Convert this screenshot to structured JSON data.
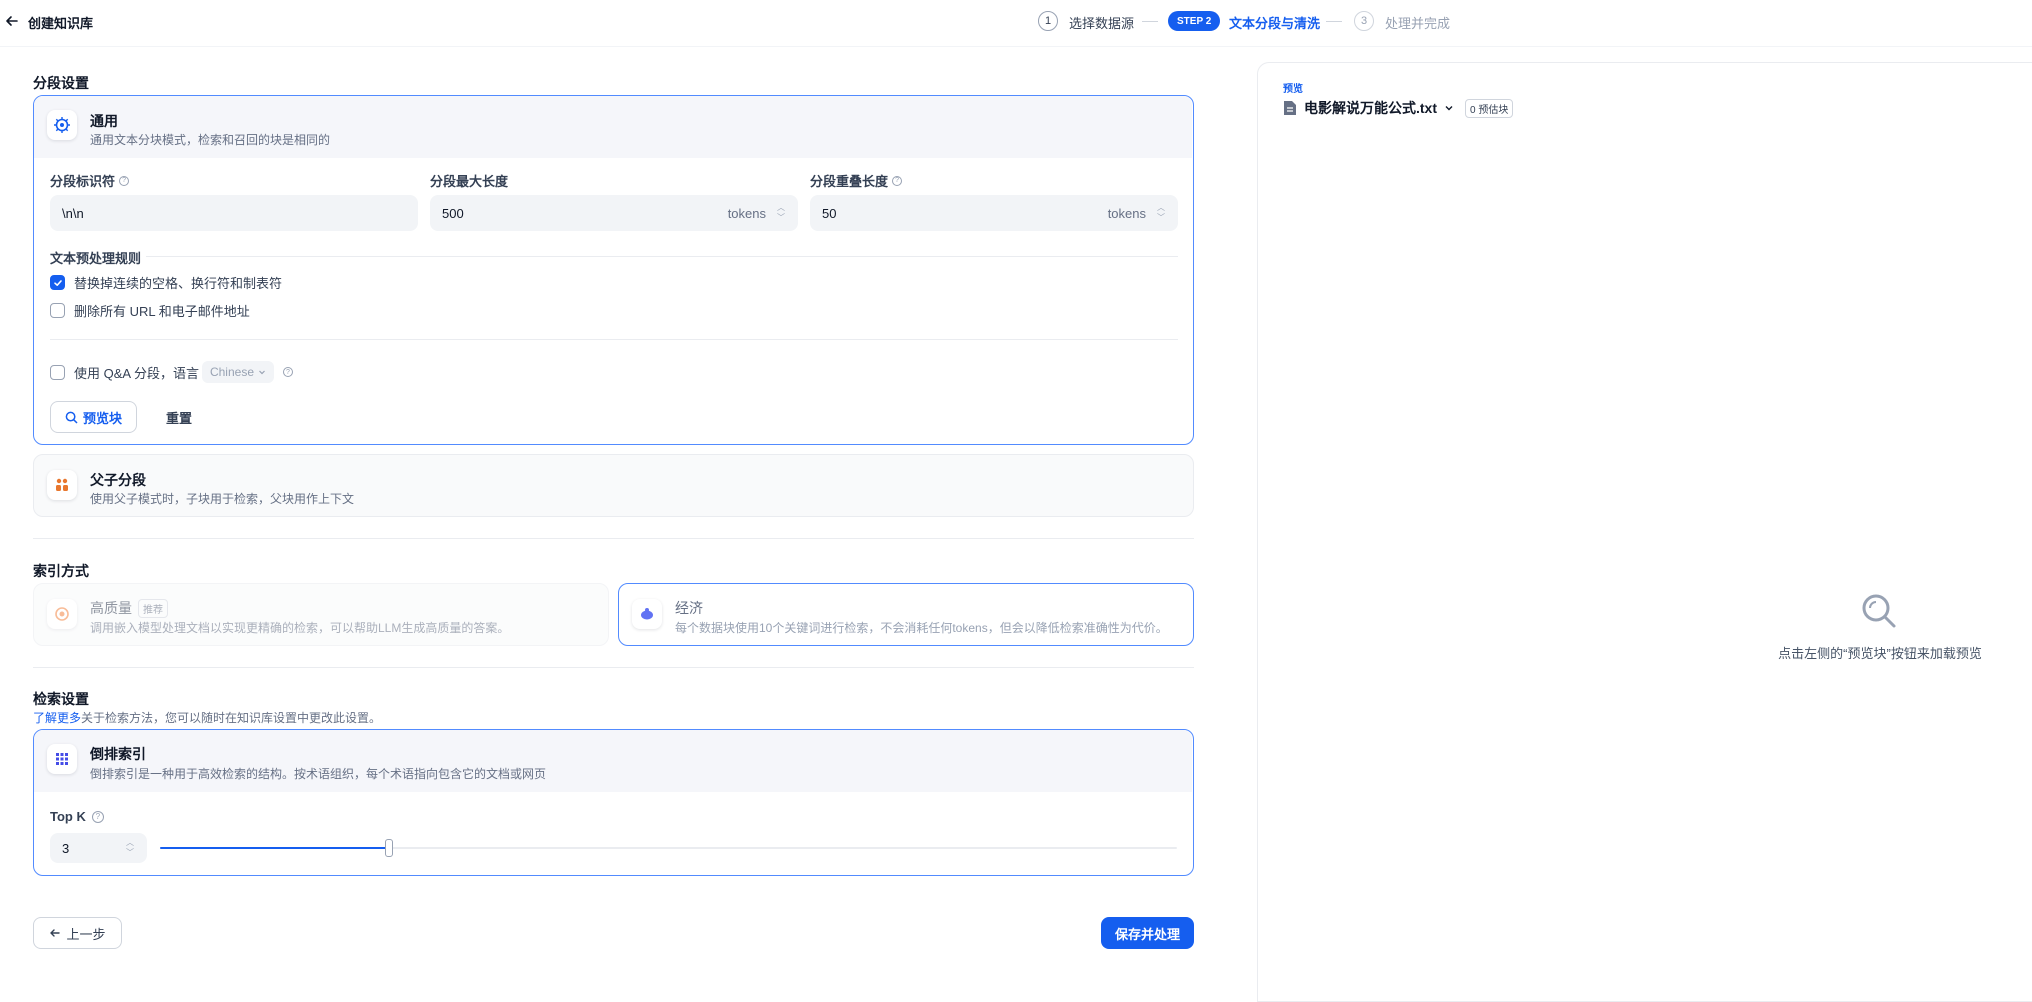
{
  "header": {
    "title": "创建知识库",
    "steps": [
      {
        "num": "1",
        "label": "选择数据源"
      },
      {
        "badge": "STEP 2",
        "label": "文本分段与清洗"
      },
      {
        "num": "3",
        "label": "处理并完成"
      }
    ]
  },
  "segment_settings": {
    "title": "分段设置",
    "general": {
      "title": "通用",
      "desc": "通用文本分块模式，检索和召回的块是相同的",
      "separator_label": "分段标识符",
      "separator_value": "\\n\\n",
      "max_length_label": "分段最大长度",
      "max_length_value": "500",
      "max_length_unit": "tokens",
      "overlap_label": "分段重叠长度",
      "overlap_value": "50",
      "overlap_unit": "tokens",
      "preprocess_title": "文本预处理规则",
      "rule_whitespace": "替换掉连续的空格、换行符和制表符",
      "rule_whitespace_checked": true,
      "rule_url": "删除所有 URL 和电子邮件地址",
      "rule_url_checked": false,
      "qa_label": "使用 Q&A 分段，语言",
      "qa_checked": false,
      "qa_language": "Chinese",
      "preview_button": "预览块",
      "reset_button": "重置"
    },
    "parent_child": {
      "title": "父子分段",
      "desc": "使用父子模式时，子块用于检索，父块用作上下文"
    }
  },
  "index_method": {
    "title": "索引方式",
    "high_quality": {
      "title": "高质量",
      "tag": "推荐",
      "desc": "调用嵌入模型处理文档以实现更精确的检索，可以帮助LLM生成高质量的答案。"
    },
    "economy": {
      "title": "经济",
      "desc": "每个数据块使用10个关键词进行检索，不会消耗任何tokens，但会以降低检索准确性为代价。"
    }
  },
  "retrieval": {
    "title": "检索设置",
    "learn_more": "了解更多",
    "note": "关于检索方法，您可以随时在知识库设置中更改此设置。",
    "inverted_index": {
      "title": "倒排索引",
      "desc": "倒排索引是一种用于高效检索的结构。按术语组织，每个术语指向包含它的文档或网页"
    },
    "topk_label": "Top K",
    "topk_value": "3",
    "topk_fraction": 0.225
  },
  "footer": {
    "prev_button": "上一步",
    "save_button": "保存并处理"
  },
  "preview": {
    "label": "预览",
    "file_name": "电影解说万能公式.txt",
    "chunk_badge": "0 预估块",
    "empty_text": "点击左侧的“预览块”按钮来加载预览"
  },
  "colors": {
    "accent": "#155eef",
    "selected_border": "#528bff"
  }
}
